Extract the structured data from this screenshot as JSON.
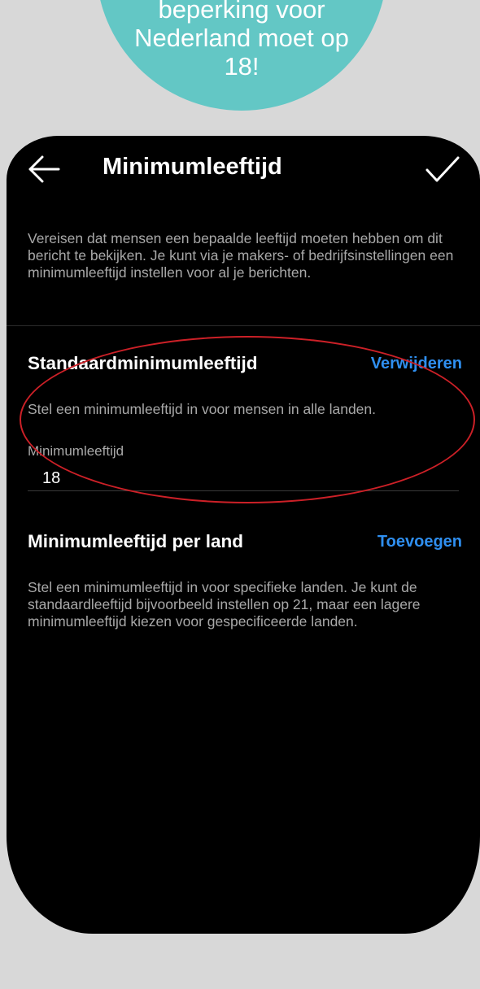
{
  "banner": {
    "lines": [
      "beperking voor",
      "Nederland moet op",
      "18!"
    ]
  },
  "header": {
    "title": "Minimumleeftijd",
    "back_icon": "arrow-left-icon",
    "confirm_icon": "checkmark-icon"
  },
  "intro": "Vereisen dat mensen een bepaalde leeftijd moeten hebben om dit bericht te bekijken. Je kunt via je makers- of bedrijfsinstellingen een minimumleeftijd instellen voor al je berichten.",
  "default_section": {
    "title": "Standaardminimumleeftijd",
    "action": "Verwijderen",
    "description": "Stel een minimumleeftijd in voor mensen in alle landen.",
    "field_label": "Minimumleeftijd",
    "field_value": "18"
  },
  "country_section": {
    "title": "Minimumleeftijd per land",
    "action": "Toevoegen",
    "description": "Stel een minimumleeftijd in voor specifieke landen. Je kunt de standaardleeftijd bijvoorbeeld instellen op 21, maar een lagere minimumleeftijd kiezen voor gespecificeerde landen."
  },
  "colors": {
    "bubble": "#63c7c5",
    "accent": "#2f8ff0",
    "highlight": "#cc2027",
    "background": "#000000"
  }
}
